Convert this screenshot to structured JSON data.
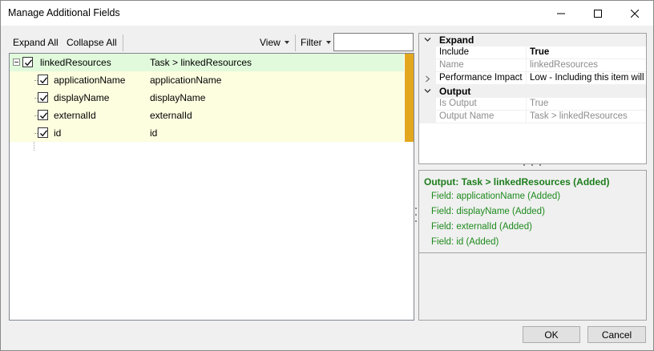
{
  "window": {
    "title": "Manage Additional Fields"
  },
  "toolbar": {
    "expand_all": "Expand All",
    "collapse_all": "Collapse All",
    "view": "View",
    "filter": "Filter",
    "filter_value": ""
  },
  "tree": {
    "root": {
      "name": "linkedResources",
      "path": "Task > linkedResources",
      "checked": true
    },
    "children": [
      {
        "name": "applicationName",
        "path": "applicationName",
        "checked": true
      },
      {
        "name": "displayName",
        "path": "displayName",
        "checked": true
      },
      {
        "name": "externalId",
        "path": "externalId",
        "checked": true
      },
      {
        "name": "id",
        "path": "id",
        "checked": true
      }
    ]
  },
  "properties": {
    "expand_category": "Expand",
    "include_label": "Include",
    "include_value": "True",
    "name_label": "Name",
    "name_value": "linkedResources",
    "impact_label": "Performance Impact",
    "impact_value": "Low - Including this item will have",
    "output_category": "Output",
    "is_output_label": "Is Output",
    "is_output_value": "True",
    "output_name_label": "Output Name",
    "output_name_value": "Task > linkedResources"
  },
  "output": {
    "header": "Output:  Task > linkedResources (Added)",
    "fields": [
      "Field: applicationName (Added)",
      "Field: displayName (Added)",
      "Field: externalId (Added)",
      "Field: id (Added)"
    ]
  },
  "buttons": {
    "ok": "OK",
    "cancel": "Cancel"
  },
  "colors": {
    "root_row_bg": "#e1fadb",
    "child_row_bg": "#fdfde0",
    "accent_strip": "#e3a71e",
    "output_green": "#1d8a1d"
  }
}
